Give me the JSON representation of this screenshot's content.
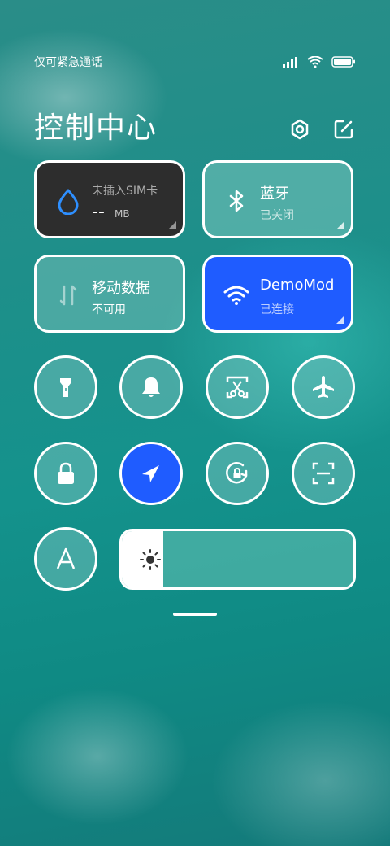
{
  "status_bar": {
    "carrier_text": "仅可紧急通话",
    "icons": [
      "signal-icon",
      "wifi-icon",
      "battery-icon"
    ]
  },
  "header": {
    "title": "控制中心",
    "icons": [
      "settings-icon",
      "edit-icon"
    ]
  },
  "cards": {
    "data_usage": {
      "title": "未插入SIM卡",
      "value": "--",
      "unit": "MB",
      "icon": "drop-icon",
      "bg": "#2d2d2d"
    },
    "bluetooth": {
      "title": "蓝牙",
      "status": "已关闭",
      "icon": "bluetooth-icon"
    },
    "mobile_data": {
      "title": "移动数据",
      "status": "不可用",
      "icon": "mobile-data-icon"
    },
    "wifi": {
      "title": "DemoMod",
      "status": "已连接",
      "icon": "wifi-icon",
      "bg": "#1f5cff"
    }
  },
  "toggles": [
    {
      "name": "flashlight",
      "icon": "flashlight-icon",
      "active": false
    },
    {
      "name": "sound",
      "icon": "bell-icon",
      "active": false
    },
    {
      "name": "screenshot",
      "icon": "screenshot-icon",
      "active": false
    },
    {
      "name": "airplane",
      "icon": "airplane-icon",
      "active": false
    },
    {
      "name": "lock-screen",
      "icon": "lock-icon",
      "active": false
    },
    {
      "name": "location",
      "icon": "location-icon",
      "active": true
    },
    {
      "name": "rotation-lock",
      "icon": "rotation-lock-icon",
      "active": false
    },
    {
      "name": "scanner",
      "icon": "scan-icon",
      "active": false
    },
    {
      "name": "auto-brightness",
      "icon": "font-a-icon",
      "active": false
    }
  ],
  "brightness": {
    "level_percent": 18,
    "icon": "sun-icon"
  },
  "colors": {
    "accent_blue": "#1f5cff",
    "dark_card": "#2d2d2d"
  }
}
